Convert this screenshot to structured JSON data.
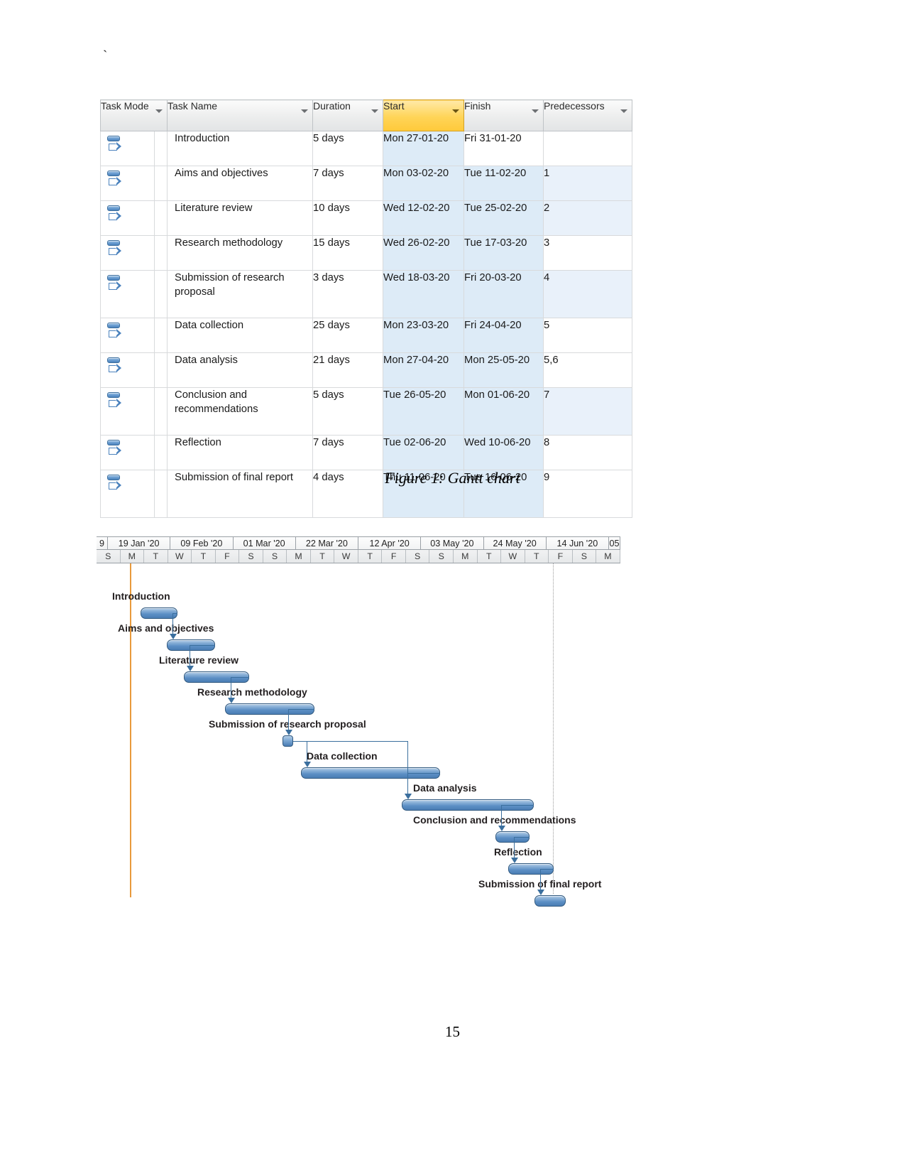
{
  "document": {
    "stray_mark": "`",
    "figure_caption": "Figure 1: Gantt chart",
    "page_number": "15"
  },
  "task_table": {
    "columns": [
      {
        "key": "task_mode",
        "label": "Task Mode",
        "has_filter": true,
        "highlighted": false
      },
      {
        "key": "task_name",
        "label": "Task Name",
        "has_filter": true,
        "highlighted": false
      },
      {
        "key": "duration",
        "label": "Duration",
        "has_filter": true,
        "highlighted": false
      },
      {
        "key": "start",
        "label": "Start",
        "has_filter": true,
        "highlighted": true
      },
      {
        "key": "finish",
        "label": "Finish",
        "has_filter": true,
        "highlighted": false
      },
      {
        "key": "predecessors",
        "label": "Predecessors",
        "has_filter": true,
        "highlighted": false
      }
    ],
    "highlight_color": "#ffd457",
    "shade_color": "#ddebf7",
    "rows": [
      {
        "mode_icon": "auto-schedule-icon",
        "task_name": "Introduction",
        "duration": "5 days",
        "start": "Mon 27-01-20",
        "finish": "Fri 31-01-20",
        "predecessors": ""
      },
      {
        "mode_icon": "auto-schedule-icon",
        "task_name": "Aims and objectives",
        "duration": "7 days",
        "start": "Mon 03-02-20",
        "finish": "Tue 11-02-20",
        "predecessors": "1"
      },
      {
        "mode_icon": "auto-schedule-icon",
        "task_name": "Literature review",
        "duration": "10 days",
        "start": "Wed 12-02-20",
        "finish": "Tue 25-02-20",
        "predecessors": "2"
      },
      {
        "mode_icon": "auto-schedule-icon",
        "task_name": "Research methodology",
        "duration": "15 days",
        "start": "Wed 26-02-20",
        "finish": "Tue 17-03-20",
        "predecessors": "3"
      },
      {
        "mode_icon": "auto-schedule-icon",
        "task_name": "Submission of research proposal",
        "duration": "3 days",
        "start": "Wed 18-03-20",
        "finish": "Fri 20-03-20",
        "predecessors": "4"
      },
      {
        "mode_icon": "auto-schedule-icon",
        "task_name": "Data collection",
        "duration": "25 days",
        "start": "Mon 23-03-20",
        "finish": "Fri 24-04-20",
        "predecessors": "5"
      },
      {
        "mode_icon": "auto-schedule-icon",
        "task_name": "Data analysis",
        "duration": "21 days",
        "start": "Mon 27-04-20",
        "finish": "Mon 25-05-20",
        "predecessors": "5,6"
      },
      {
        "mode_icon": "auto-schedule-icon",
        "task_name": "Conclusion and recommendations",
        "duration": "5 days",
        "start": "Tue 26-05-20",
        "finish": "Mon 01-06-20",
        "predecessors": "7"
      },
      {
        "mode_icon": "auto-schedule-icon",
        "task_name": "Reflection",
        "duration": "7 days",
        "start": "Tue 02-06-20",
        "finish": "Wed 10-06-20",
        "predecessors": "8"
      },
      {
        "mode_icon": "auto-schedule-icon",
        "task_name": "Submission of final report",
        "duration": "4 days",
        "start": "Thu 11-06-20",
        "finish": "Tue 16-06-20",
        "predecessors": "9"
      }
    ]
  },
  "chart_data": {
    "type": "bar",
    "title": "Figure 1: Gantt chart",
    "orientation": "horizontal-timeline",
    "xlabel": "",
    "ylabel": "",
    "grid": false,
    "legend": "none",
    "timeline_header": {
      "month_ticks": [
        "9",
        "19 Jan '20",
        "09 Feb '20",
        "01 Mar '20",
        "22 Mar '20",
        "12 Apr '20",
        "03 May '20",
        "24 May '20",
        "14 Jun '20",
        "05"
      ],
      "day_ticks": [
        "S",
        "M",
        "T",
        "W",
        "T",
        "F",
        "S",
        "S",
        "M",
        "T",
        "W",
        "T",
        "F",
        "S",
        "S",
        "M",
        "T",
        "W",
        "T",
        "F",
        "S",
        "M"
      ]
    },
    "markers": [
      {
        "name": "project-start-line",
        "color": "#e89a3c",
        "style": "solid"
      },
      {
        "name": "status-date-line",
        "color": "#9a9a9a",
        "style": "dotted"
      }
    ],
    "categories": [
      "Introduction",
      "Aims and objectives",
      "Literature review",
      "Research methodology",
      "Submission of research proposal",
      "Data collection",
      "Data analysis",
      "Conclusion and recommendations",
      "Reflection",
      "Submission of final report"
    ],
    "values": [
      5,
      7,
      10,
      15,
      3,
      25,
      21,
      5,
      7,
      4
    ],
    "bars": [
      {
        "label": "Introduction",
        "start": "Mon 27-01-20",
        "finish": "Fri 31-01-20",
        "duration_days": 5,
        "shape": "bar",
        "predecessors": ""
      },
      {
        "label": "Aims and objectives",
        "start": "Mon 03-02-20",
        "finish": "Tue 11-02-20",
        "duration_days": 7,
        "shape": "bar",
        "predecessors": "1"
      },
      {
        "label": "Literature review",
        "start": "Wed 12-02-20",
        "finish": "Tue 25-02-20",
        "duration_days": 10,
        "shape": "bar",
        "predecessors": "2"
      },
      {
        "label": "Research methodology",
        "start": "Wed 26-02-20",
        "finish": "Tue 17-03-20",
        "duration_days": 15,
        "shape": "bar",
        "predecessors": "3"
      },
      {
        "label": "Submission of research proposal",
        "start": "Wed 18-03-20",
        "finish": "Fri 20-03-20",
        "duration_days": 3,
        "shape": "milestone",
        "predecessors": "4"
      },
      {
        "label": "Data collection",
        "start": "Mon 23-03-20",
        "finish": "Fri 24-04-20",
        "duration_days": 25,
        "shape": "bar",
        "predecessors": "5"
      },
      {
        "label": "Data analysis",
        "start": "Mon 27-04-20",
        "finish": "Mon 25-05-20",
        "duration_days": 21,
        "shape": "bar",
        "predecessors": "5,6"
      },
      {
        "label": "Conclusion and recommendations",
        "start": "Tue 26-05-20",
        "finish": "Mon 01-06-20",
        "duration_days": 5,
        "shape": "bar",
        "predecessors": "7"
      },
      {
        "label": "Reflection",
        "start": "Tue 02-06-20",
        "finish": "Wed 10-06-20",
        "duration_days": 7,
        "shape": "bar",
        "predecessors": "8"
      },
      {
        "label": "Submission of final report",
        "start": "Thu 11-06-20",
        "finish": "Tue 16-06-20",
        "duration_days": 4,
        "shape": "bar",
        "predecessors": "9"
      }
    ],
    "bar_color": "#4a7db4"
  }
}
